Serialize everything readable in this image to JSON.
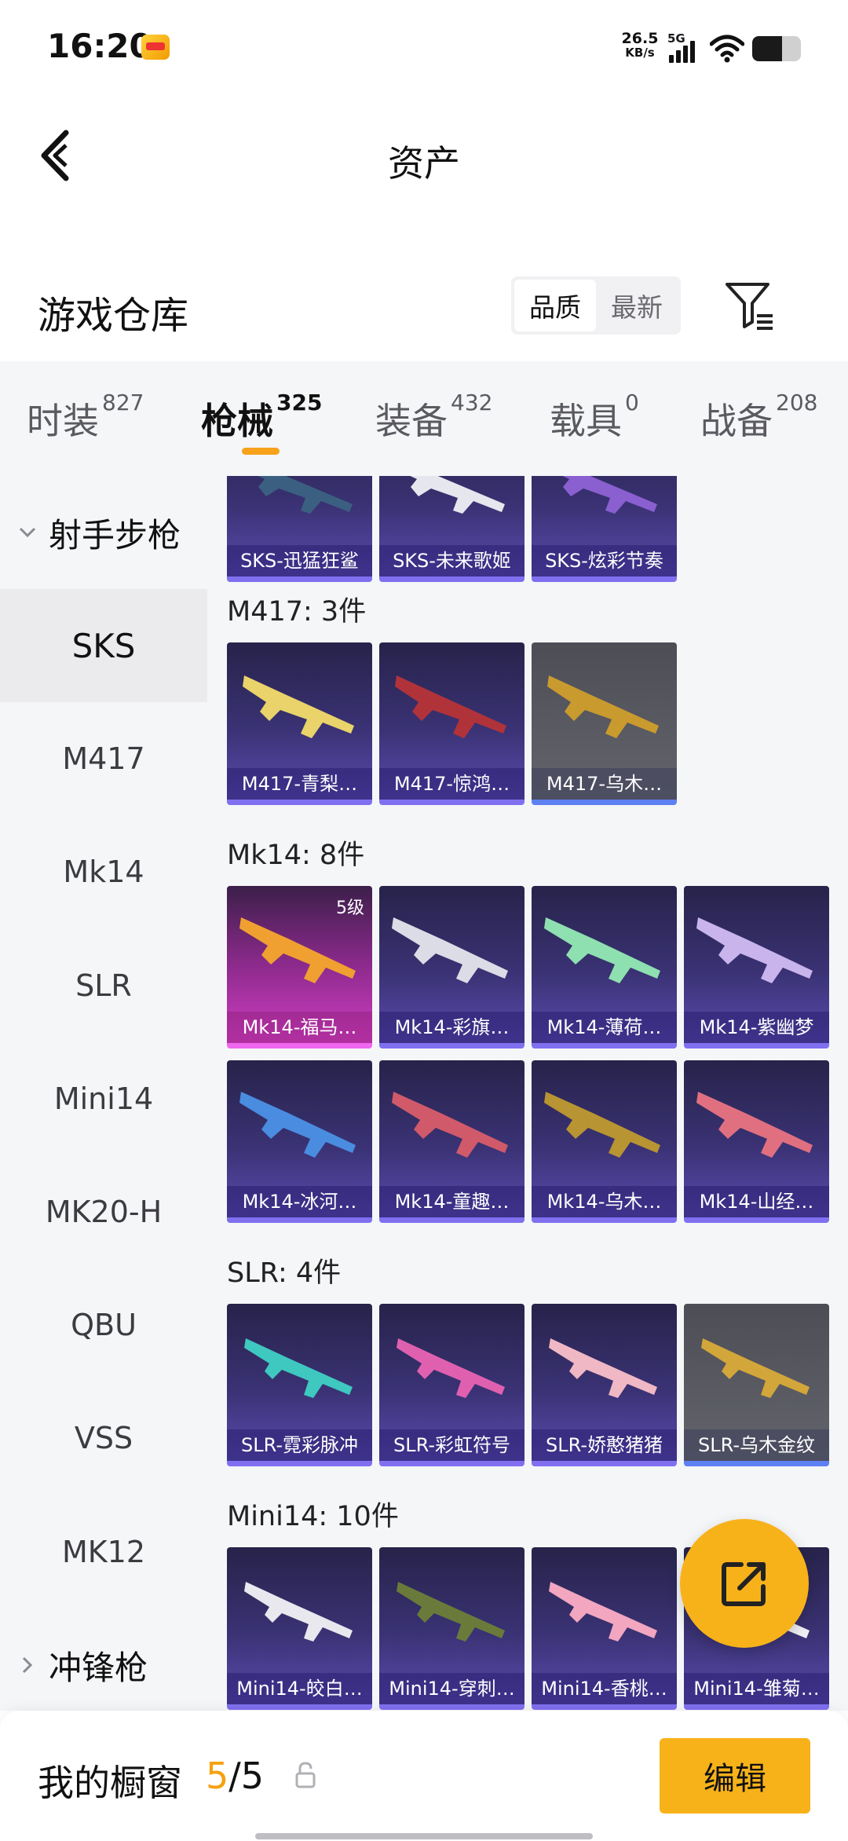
{
  "status": {
    "time": "16:20",
    "net_speed": "26.5",
    "net_unit": "KB/s",
    "network": "5G"
  },
  "header": {
    "title": "资产"
  },
  "section": {
    "title": "游戏仓库",
    "sort_options": [
      "品质",
      "最新"
    ],
    "active_sort": "品质"
  },
  "tabs": [
    {
      "label": "时装",
      "count": "827"
    },
    {
      "label": "枪械",
      "count": "325",
      "active": true
    },
    {
      "label": "装备",
      "count": "432"
    },
    {
      "label": "载具",
      "count": "0"
    },
    {
      "label": "战备",
      "count": "208"
    }
  ],
  "sidebar": {
    "group1": "射手步枪",
    "items": [
      "SKS",
      "M417",
      "Mk14",
      "SLR",
      "Mini14",
      "MK20-H",
      "QBU",
      "VSS",
      "MK12"
    ],
    "active_item": "SKS",
    "group2": "冲锋枪"
  },
  "groups": {
    "sks": {
      "items": [
        "SKS-迅猛狂鲨",
        "SKS-未来歌姬",
        "SKS-炫彩节奏"
      ]
    },
    "m417": {
      "label": "M417: 3件",
      "items": [
        "M417-青梨…",
        "M417-惊鸿…",
        "M417-乌木…"
      ]
    },
    "mk14": {
      "label": "Mk14: 8件",
      "tier": "5级",
      "items": [
        "Mk14-福马…",
        "Mk14-彩旗…",
        "Mk14-薄荷…",
        "Mk14-紫幽梦",
        "Mk14-冰河…",
        "Mk14-童趣…",
        "Mk14-乌木…",
        "Mk14-山经…"
      ]
    },
    "slr": {
      "label": "SLR: 4件",
      "items": [
        "SLR-霓彩脉冲",
        "SLR-彩虹符号",
        "SLR-娇憨猪猪",
        "SLR-乌木金纹"
      ]
    },
    "mini14": {
      "label": "Mini14: 10件",
      "items": [
        "Mini14-皎白…",
        "Mini14-穿刺…",
        "Mini14-香桃…",
        "Mini14-雏菊…"
      ]
    }
  },
  "bottom": {
    "title": "我的橱窗",
    "current": "5",
    "total": "/5",
    "edit_label": "编辑"
  },
  "colors": {
    "accent": "#f7b21a",
    "card_purple": "#3a3274",
    "card_gray": "#5a5b63",
    "card_pink": "#d13ec3"
  }
}
